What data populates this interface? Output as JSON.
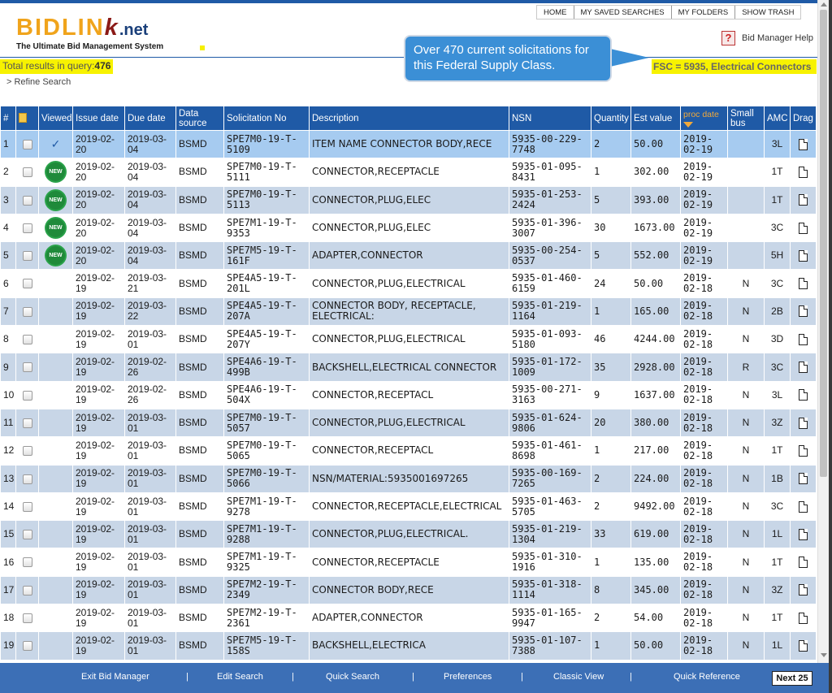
{
  "logo": {
    "part1": "BIDLIN",
    "part2": "k",
    "part3": ".net",
    "tagline": "The Ultimate Bid Management System"
  },
  "topnav": [
    "HOME",
    "MY SAVED SEARCHES",
    "MY FOLDERS",
    "SHOW TRASH"
  ],
  "help": {
    "label": "Bid Manager Help"
  },
  "results": {
    "label": "Total results in query:",
    "count": "476"
  },
  "fsc": "FSC = 5935, Electrical Connectors",
  "refine": "> Refine Search",
  "callout": "Over 470 current solicitations for this Federal Supply Class.",
  "columns": {
    "num": "#",
    "viewed": "Viewed",
    "issue": "Issue date",
    "due": "Due date",
    "source": "Data source",
    "sol": "Solicitation No",
    "desc": "Description",
    "nsn": "NSN",
    "qty": "Quantity",
    "est": "Est value",
    "proc": "proc date",
    "small": "Small bus",
    "amc": "AMC",
    "drag": "Drag"
  },
  "rows": [
    {
      "num": "1",
      "viewed": "check",
      "issue": "2019-02-20",
      "due": "2019-03-04",
      "source": "BSMD",
      "sol": "SPE7M0-19-T-5109",
      "desc": "ITEM NAME CONNECTOR BODY,RECE",
      "nsn": "5935-00-229-7748",
      "qty": "2",
      "est": "50.00",
      "proc": "2019-02-19",
      "small": "",
      "amc": "3L"
    },
    {
      "num": "2",
      "viewed": "new",
      "issue": "2019-02-20",
      "due": "2019-03-04",
      "source": "BSMD",
      "sol": "SPE7M0-19-T-5111",
      "desc": "CONNECTOR,RECEPTACLE",
      "nsn": "5935-01-095-8431",
      "qty": "1",
      "est": "302.00",
      "proc": "2019-02-19",
      "small": "",
      "amc": "1T"
    },
    {
      "num": "3",
      "viewed": "new",
      "issue": "2019-02-20",
      "due": "2019-03-04",
      "source": "BSMD",
      "sol": "SPE7M0-19-T-5113",
      "desc": "CONNECTOR,PLUG,ELEC",
      "nsn": "5935-01-253-2424",
      "qty": "5",
      "est": "393.00",
      "proc": "2019-02-19",
      "small": "",
      "amc": "1T"
    },
    {
      "num": "4",
      "viewed": "new",
      "issue": "2019-02-20",
      "due": "2019-03-04",
      "source": "BSMD",
      "sol": "SPE7M1-19-T-9353",
      "desc": "CONNECTOR,PLUG,ELEC",
      "nsn": "5935-01-396-3007",
      "qty": "30",
      "est": "1673.00",
      "proc": "2019-02-19",
      "small": "",
      "amc": "3C"
    },
    {
      "num": "5",
      "viewed": "new",
      "issue": "2019-02-20",
      "due": "2019-03-04",
      "source": "BSMD",
      "sol": "SPE7M5-19-T-161F",
      "desc": "ADAPTER,CONNECTOR",
      "nsn": "5935-00-254-0537",
      "qty": "5",
      "est": "552.00",
      "proc": "2019-02-19",
      "small": "",
      "amc": "5H"
    },
    {
      "num": "6",
      "viewed": "",
      "issue": "2019-02-19",
      "due": "2019-03-21",
      "source": "BSMD",
      "sol": "SPE4A5-19-T-201L",
      "desc": "CONNECTOR,PLUG,ELECTRICAL",
      "nsn": "5935-01-460-6159",
      "qty": "24",
      "est": "50.00",
      "proc": "2019-02-18",
      "small": "N",
      "amc": "3C"
    },
    {
      "num": "7",
      "viewed": "",
      "issue": "2019-02-19",
      "due": "2019-03-22",
      "source": "BSMD",
      "sol": "SPE4A5-19-T-207A",
      "desc": "CONNECTOR BODY, RECEPTACLE, ELECTRICAL:",
      "nsn": "5935-01-219-1164",
      "qty": "1",
      "est": "165.00",
      "proc": "2019-02-18",
      "small": "N",
      "amc": "2B"
    },
    {
      "num": "8",
      "viewed": "",
      "issue": "2019-02-19",
      "due": "2019-03-01",
      "source": "BSMD",
      "sol": "SPE4A5-19-T-207Y",
      "desc": "CONNECTOR,PLUG,ELECTRICAL",
      "nsn": "5935-01-093-5180",
      "qty": "46",
      "est": "4244.00",
      "proc": "2019-02-18",
      "small": "N",
      "amc": "3D"
    },
    {
      "num": "9",
      "viewed": "",
      "issue": "2019-02-19",
      "due": "2019-02-26",
      "source": "BSMD",
      "sol": "SPE4A6-19-T-499B",
      "desc": "BACKSHELL,ELECTRICAL CONNECTOR",
      "nsn": "5935-01-172-1009",
      "qty": "35",
      "est": "2928.00",
      "proc": "2019-02-18",
      "small": "R",
      "amc": "3C"
    },
    {
      "num": "10",
      "viewed": "",
      "issue": "2019-02-19",
      "due": "2019-02-26",
      "source": "BSMD",
      "sol": "SPE4A6-19-T-504X",
      "desc": "CONNECTOR,RECEPTACL",
      "nsn": "5935-00-271-3163",
      "qty": "9",
      "est": "1637.00",
      "proc": "2019-02-18",
      "small": "N",
      "amc": "3L"
    },
    {
      "num": "11",
      "viewed": "",
      "issue": "2019-02-19",
      "due": "2019-03-01",
      "source": "BSMD",
      "sol": "SPE7M0-19-T-5057",
      "desc": "CONNECTOR,PLUG,ELECTRICAL",
      "nsn": "5935-01-624-9806",
      "qty": "20",
      "est": "380.00",
      "proc": "2019-02-18",
      "small": "N",
      "amc": "3Z"
    },
    {
      "num": "12",
      "viewed": "",
      "issue": "2019-02-19",
      "due": "2019-03-01",
      "source": "BSMD",
      "sol": "SPE7M0-19-T-5065",
      "desc": "CONNECTOR,RECEPTACL",
      "nsn": "5935-01-461-8698",
      "qty": "1",
      "est": "217.00",
      "proc": "2019-02-18",
      "small": "N",
      "amc": "1T"
    },
    {
      "num": "13",
      "viewed": "",
      "issue": "2019-02-19",
      "due": "2019-03-01",
      "source": "BSMD",
      "sol": "SPE7M0-19-T-5066",
      "desc": "NSN/MATERIAL:5935001697265",
      "nsn": "5935-00-169-7265",
      "qty": "2",
      "est": "224.00",
      "proc": "2019-02-18",
      "small": "N",
      "amc": "1B"
    },
    {
      "num": "14",
      "viewed": "",
      "issue": "2019-02-19",
      "due": "2019-03-01",
      "source": "BSMD",
      "sol": "SPE7M1-19-T-9278",
      "desc": "CONNECTOR,RECEPTACLE,ELECTRICAL",
      "nsn": "5935-01-463-5705",
      "qty": "2",
      "est": "9492.00",
      "proc": "2019-02-18",
      "small": "N",
      "amc": "3C"
    },
    {
      "num": "15",
      "viewed": "",
      "issue": "2019-02-19",
      "due": "2019-03-01",
      "source": "BSMD",
      "sol": "SPE7M1-19-T-9288",
      "desc": "CONNECTOR,PLUG,ELECTRICAL.",
      "nsn": "5935-01-219-1304",
      "qty": "33",
      "est": "619.00",
      "proc": "2019-02-18",
      "small": "N",
      "amc": "1L"
    },
    {
      "num": "16",
      "viewed": "",
      "issue": "2019-02-19",
      "due": "2019-03-01",
      "source": "BSMD",
      "sol": "SPE7M1-19-T-9325",
      "desc": "CONNECTOR,RECEPTACLE",
      "nsn": "5935-01-310-1916",
      "qty": "1",
      "est": "135.00",
      "proc": "2019-02-18",
      "small": "N",
      "amc": "1T"
    },
    {
      "num": "17",
      "viewed": "",
      "issue": "2019-02-19",
      "due": "2019-03-01",
      "source": "BSMD",
      "sol": "SPE7M2-19-T-2349",
      "desc": "CONNECTOR BODY,RECE",
      "nsn": "5935-01-318-1114",
      "qty": "8",
      "est": "345.00",
      "proc": "2019-02-18",
      "small": "N",
      "amc": "3Z"
    },
    {
      "num": "18",
      "viewed": "",
      "issue": "2019-02-19",
      "due": "2019-03-01",
      "source": "BSMD",
      "sol": "SPE7M2-19-T-2361",
      "desc": "ADAPTER,CONNECTOR",
      "nsn": "5935-01-165-9947",
      "qty": "2",
      "est": "54.00",
      "proc": "2019-02-18",
      "small": "N",
      "amc": "1T"
    },
    {
      "num": "19",
      "viewed": "",
      "issue": "2019-02-19",
      "due": "2019-03-01",
      "source": "BSMD",
      "sol": "SPE7M5-19-T-158S",
      "desc": "BACKSHELL,ELECTRICA",
      "nsn": "5935-01-107-7388",
      "qty": "1",
      "est": "50.00",
      "proc": "2019-02-18",
      "small": "N",
      "amc": "1L"
    }
  ],
  "footer": {
    "links": [
      "Exit Bid Manager",
      "Edit Search",
      "Quick Search",
      "Preferences",
      "Classic View",
      "Quick Reference"
    ],
    "separator": "|",
    "next": "Next 25"
  },
  "colors": {
    "header_blue": "#1f5aa6",
    "highlight_yellow": "#f7f200",
    "row_alt": "#c8d6e7",
    "row_selected": "#a6cbf0",
    "callout_blue": "#3b8fd6"
  }
}
